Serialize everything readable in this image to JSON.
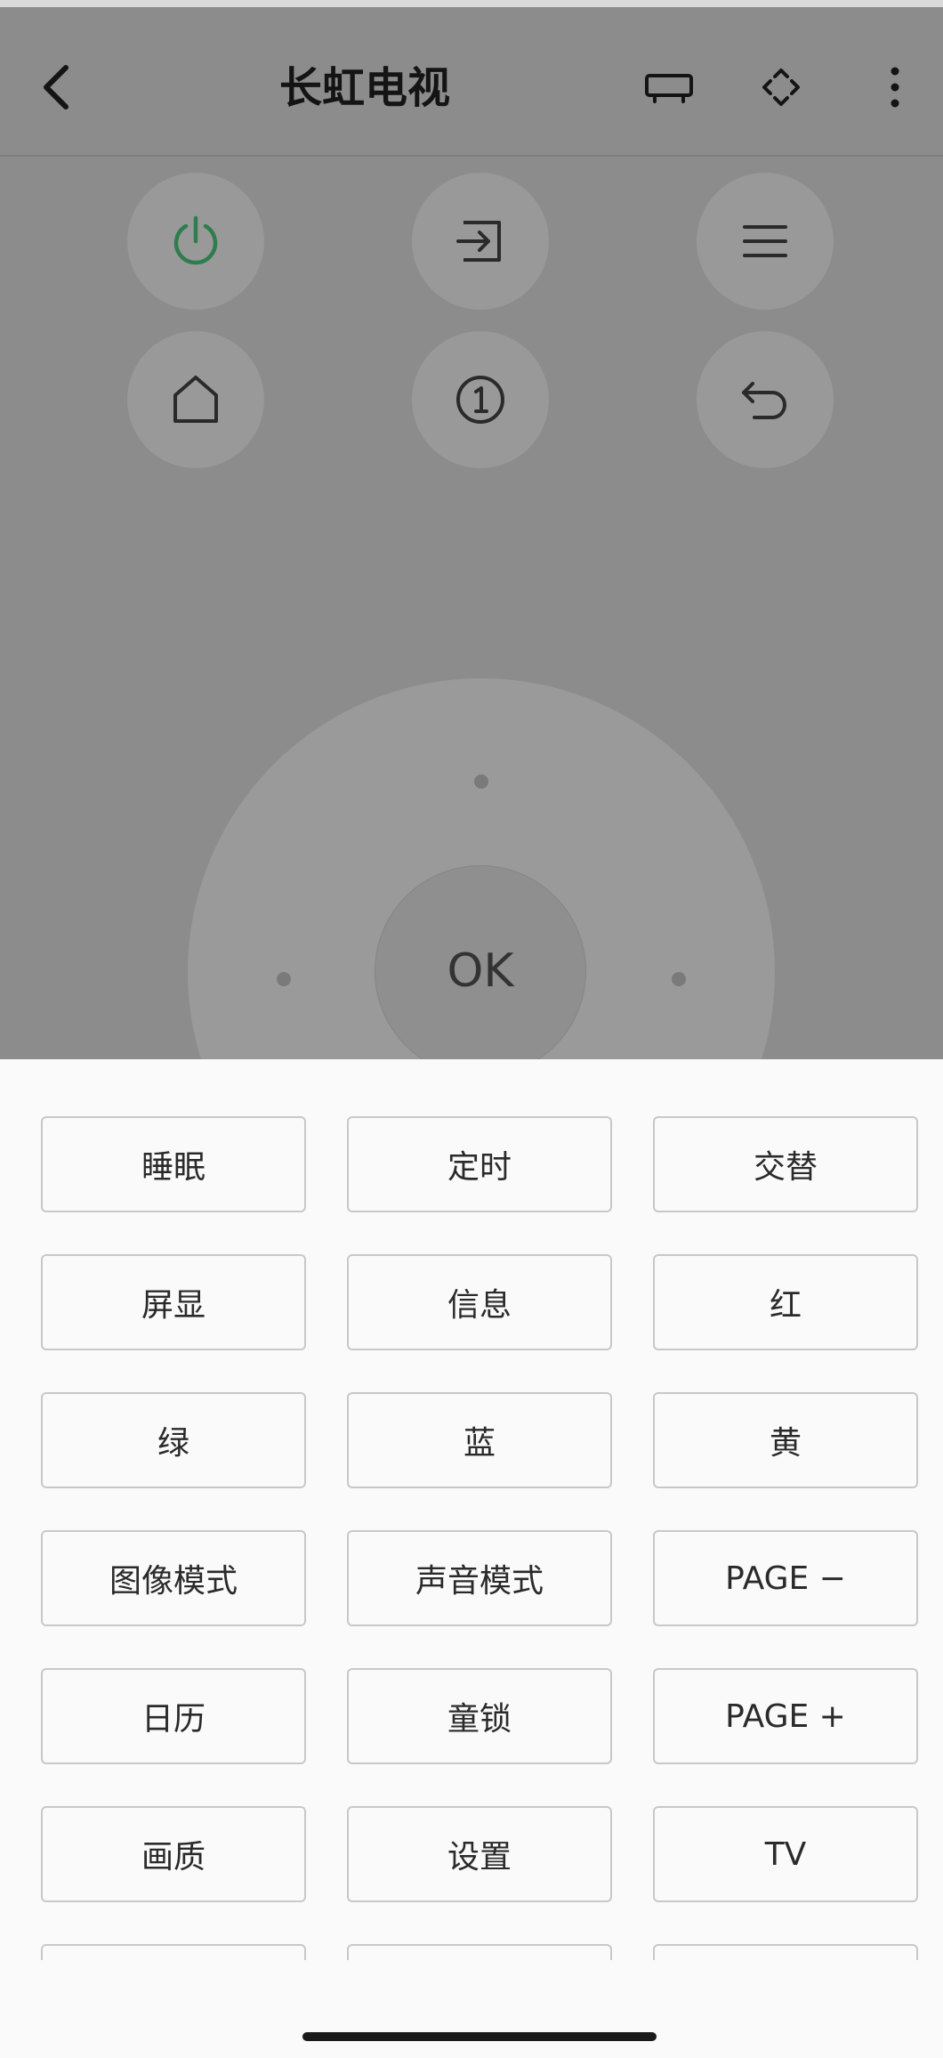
{
  "header": {
    "title": "长虹电视",
    "back_icon": "chevron-left-icon",
    "actions": [
      "tv-icon",
      "dpad-icon",
      "more-vertical-icon"
    ]
  },
  "remote": {
    "top_buttons": [
      {
        "name": "power-button",
        "icon": "power-icon",
        "color": "#2e7d4f"
      },
      {
        "name": "input-button",
        "icon": "input-source-icon"
      },
      {
        "name": "menu-button",
        "icon": "menu-icon"
      },
      {
        "name": "home-button",
        "icon": "home-icon"
      },
      {
        "name": "number-button",
        "icon": "number-one-icon",
        "label": "1"
      },
      {
        "name": "back-button",
        "icon": "return-icon"
      }
    ],
    "ok_label": "OK"
  },
  "keys": {
    "rows": [
      [
        "睡眠",
        "定时",
        "交替"
      ],
      [
        "屏显",
        "信息",
        "红"
      ],
      [
        "绿",
        "蓝",
        "黄"
      ],
      [
        "图像模式",
        "声音模式",
        "PAGE −"
      ],
      [
        "日历",
        "童锁",
        "PAGE +"
      ],
      [
        "画质",
        "设置",
        "TV"
      ]
    ]
  },
  "colors": {
    "overlay": "#8c8c8c",
    "power_accent": "#2e7d4f",
    "sheet_bg": "#fafafa"
  }
}
